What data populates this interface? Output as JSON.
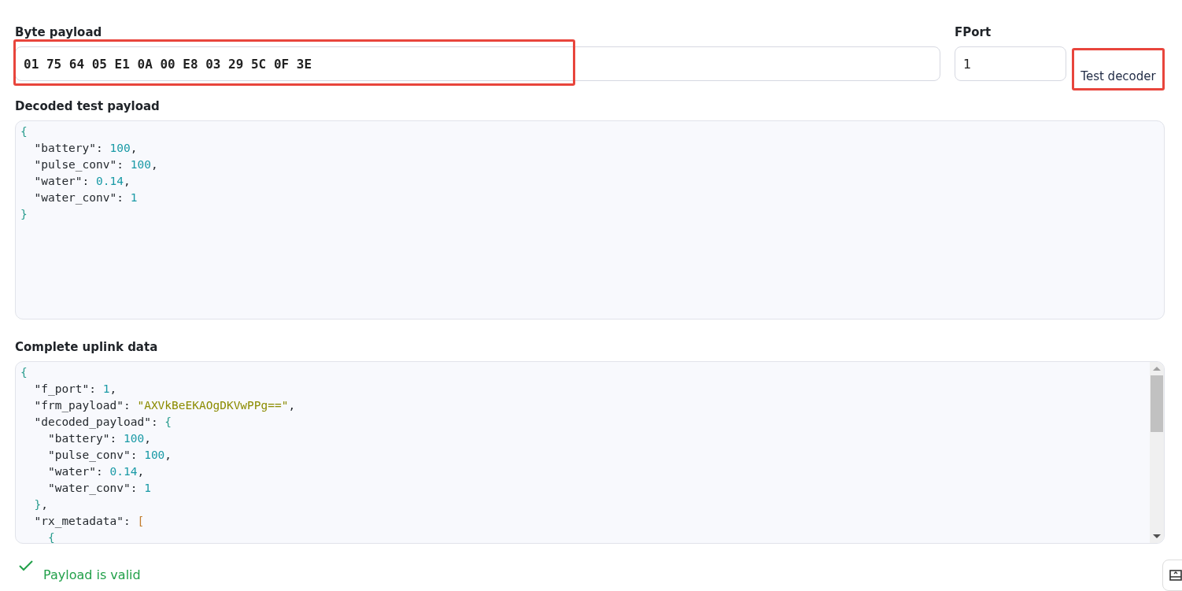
{
  "byte_payload": {
    "label": "Byte payload",
    "value": "01 75 64 05 E1 0A 00 E8 03 29 5C 0F 3E",
    "highlighted": true
  },
  "fport": {
    "label": "FPort",
    "value": "1"
  },
  "test_button": {
    "label": "Test decoder",
    "highlighted": true
  },
  "decoded": {
    "label": "Decoded test payload",
    "lines": [
      [
        {
          "kind": "brace",
          "text": "{"
        }
      ],
      [
        {
          "kind": "key",
          "text": "  \"battery\""
        },
        {
          "kind": "punct",
          "text": ": "
        },
        {
          "kind": "number",
          "text": "100"
        },
        {
          "kind": "punct",
          "text": ","
        }
      ],
      [
        {
          "kind": "key",
          "text": "  \"pulse_conv\""
        },
        {
          "kind": "punct",
          "text": ": "
        },
        {
          "kind": "number",
          "text": "100"
        },
        {
          "kind": "punct",
          "text": ","
        }
      ],
      [
        {
          "kind": "key",
          "text": "  \"water\""
        },
        {
          "kind": "punct",
          "text": ": "
        },
        {
          "kind": "number",
          "text": "0.14"
        },
        {
          "kind": "punct",
          "text": ","
        }
      ],
      [
        {
          "kind": "key",
          "text": "  \"water_conv\""
        },
        {
          "kind": "punct",
          "text": ": "
        },
        {
          "kind": "number",
          "text": "1"
        }
      ],
      [
        {
          "kind": "brace",
          "text": "}"
        }
      ]
    ]
  },
  "uplink": {
    "label": "Complete uplink data",
    "lines": [
      [
        {
          "kind": "brace",
          "text": "{"
        }
      ],
      [
        {
          "kind": "key",
          "text": "  \"f_port\""
        },
        {
          "kind": "punct",
          "text": ": "
        },
        {
          "kind": "number",
          "text": "1"
        },
        {
          "kind": "punct",
          "text": ","
        }
      ],
      [
        {
          "kind": "key",
          "text": "  \"frm_payload\""
        },
        {
          "kind": "punct",
          "text": ": "
        },
        {
          "kind": "string",
          "text": "\"AXVkBeEKAOgDKVwPPg==\""
        },
        {
          "kind": "punct",
          "text": ","
        }
      ],
      [
        {
          "kind": "key",
          "text": "  \"decoded_payload\""
        },
        {
          "kind": "punct",
          "text": ": "
        },
        {
          "kind": "brace",
          "text": "{"
        }
      ],
      [
        {
          "kind": "key",
          "text": "    \"battery\""
        },
        {
          "kind": "punct",
          "text": ": "
        },
        {
          "kind": "number",
          "text": "100"
        },
        {
          "kind": "punct",
          "text": ","
        }
      ],
      [
        {
          "kind": "key",
          "text": "    \"pulse_conv\""
        },
        {
          "kind": "punct",
          "text": ": "
        },
        {
          "kind": "number",
          "text": "100"
        },
        {
          "kind": "punct",
          "text": ","
        }
      ],
      [
        {
          "kind": "key",
          "text": "    \"water\""
        },
        {
          "kind": "punct",
          "text": ": "
        },
        {
          "kind": "number",
          "text": "0.14"
        },
        {
          "kind": "punct",
          "text": ","
        }
      ],
      [
        {
          "kind": "key",
          "text": "    \"water_conv\""
        },
        {
          "kind": "punct",
          "text": ": "
        },
        {
          "kind": "number",
          "text": "1"
        }
      ],
      [
        {
          "kind": "brace",
          "text": "  }"
        },
        {
          "kind": "punct",
          "text": ","
        }
      ],
      [
        {
          "kind": "key",
          "text": "  \"rx_metadata\""
        },
        {
          "kind": "punct",
          "text": ": "
        },
        {
          "kind": "bracket",
          "text": "["
        }
      ],
      [
        {
          "kind": "brace",
          "text": "    {"
        }
      ]
    ]
  },
  "status": {
    "text": "Payload is valid",
    "valid": true
  }
}
